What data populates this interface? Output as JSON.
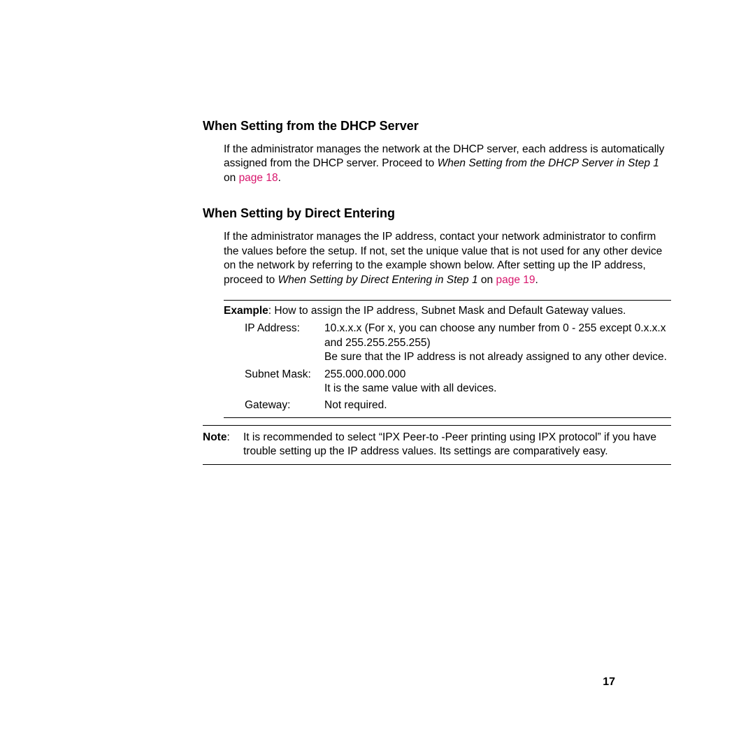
{
  "section1": {
    "heading": "When Setting from the DHCP Server",
    "para_pre": "If the administrator manages the network at the DHCP server, each address is automatically assigned from the DHCP server. Proceed to ",
    "para_italic": "When Setting from the DHCP Server in Step 1",
    "para_mid": " on ",
    "para_link": "page 18",
    "para_end": "."
  },
  "section2": {
    "heading": "When Setting by Direct Entering",
    "para_pre": "If the administrator manages the IP address, contact your network administrator to confirm the values before the setup. If not, set the unique value that is not used for any other device on the network by referring to the example shown below. After setting up the IP address, proceed to ",
    "para_italic": "When Setting by Direct Entering in Step 1",
    "para_mid": " on ",
    "para_link": "page 19",
    "para_end": "."
  },
  "example": {
    "label": "Example",
    "text": ":  How to assign the IP address, Subnet Mask and Default Gateway values.",
    "rows": {
      "ip_label": "IP Address:",
      "ip_value1": "10.x.x.x (For x, you can choose any number from 0 - 255 except 0.x.x.x and 255.255.255.255)",
      "ip_value2": "Be sure that the IP address is not already assigned to any other device.",
      "subnet_label": "Subnet Mask:",
      "subnet_value1": "255.000.000.000",
      "subnet_value2": "It is the same value with all devices.",
      "gateway_label": "Gateway:",
      "gateway_value": "Not required."
    }
  },
  "note": {
    "label": "Note",
    "text": "It is recommended to select “IPX Peer-to -Peer printing using IPX protocol” if you have trouble setting up the IP address values. Its settings are comparatively easy."
  },
  "page_number": "17"
}
